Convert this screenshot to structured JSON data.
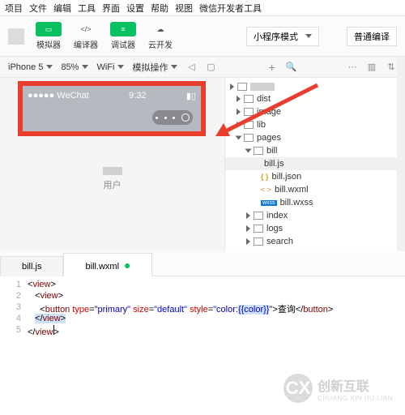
{
  "menu": [
    "项目",
    "文件",
    "编辑",
    "工具",
    "界面",
    "设置",
    "帮助",
    "视图",
    "微信开发者工具"
  ],
  "toolbar": {
    "simulator": "模拟器",
    "compiler": "编译器",
    "debugger": "调试器",
    "cloud": "云开发",
    "mode": "小程序模式",
    "compile": "普通编译"
  },
  "filter": {
    "device": "iPhone 5",
    "zoom": "85%",
    "network": "WiFi",
    "simop": "模拟操作"
  },
  "sim": {
    "carrier": "●●●●● WeChat",
    "time": "9:32",
    "user": "用户"
  },
  "tree": {
    "dist": "dist",
    "image": "image",
    "lib": "lib",
    "pages": "pages",
    "bill": "bill",
    "billjs": "bill.js",
    "billjson": "bill.json",
    "billwxml": "bill.wxml",
    "billwxss": "bill.wxss",
    "index": "index",
    "logs": "logs",
    "search": "search"
  },
  "tabs": {
    "t1": "bill.js",
    "t2": "bill.wxml"
  },
  "code": {
    "l1": "<view>",
    "l2a": "<view>",
    "l3_btn": "button",
    "l3_type": "type",
    "l3_typev": "\"primary\"",
    "l3_size": "size",
    "l3_sizev": "\"default\"",
    "l3_style": "style",
    "l3_stylev": "\"color:{{color}}\"",
    "l3_txt": "查询",
    "l3_cbtn": "button",
    "l4": "</view>",
    "l5": "</view"
  },
  "logo": {
    "brand": "创新互联",
    "sub": "CHUANG XIN HU LIAN",
    "x": "CX"
  }
}
